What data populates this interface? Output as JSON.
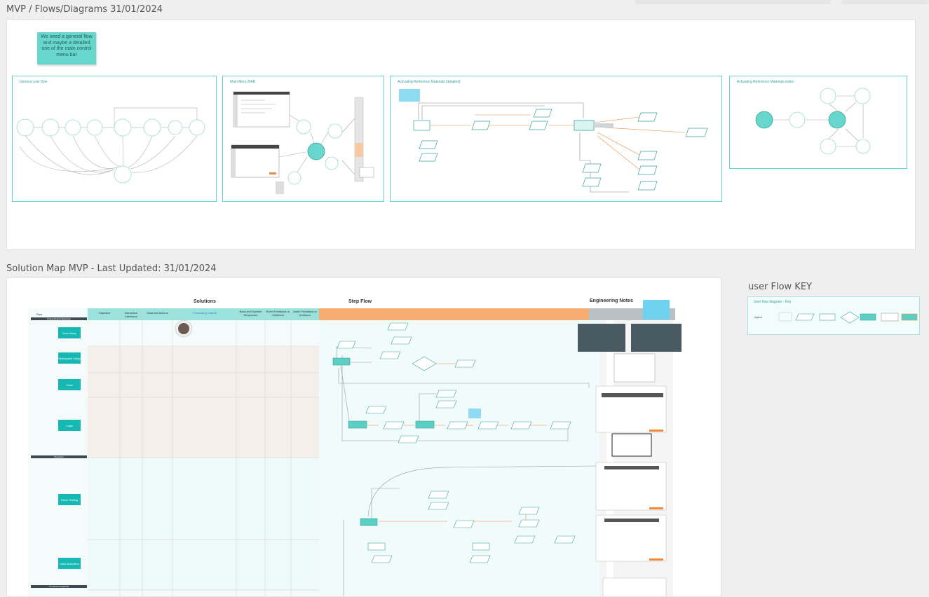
{
  "frames": {
    "mvp": {
      "title": "MVP / Flows/Diagrams 31/01/2024",
      "sticky_note": "We need a general flow and maybe a detailed one of the main control menu bar",
      "sub_frames": [
        {
          "title": "General user flow"
        },
        {
          "title": "Main Menu BAR"
        },
        {
          "title": "Activating Reference Materials [detailed]"
        },
        {
          "title": "Activating Reference Materials index"
        }
      ]
    },
    "solution_map": {
      "title": "Solution Map MVP - Last Updated: 31/01/2024",
      "section_headers": [
        "Solutions",
        "Step Flow",
        "Engineering Notes"
      ],
      "row_header": "Row",
      "column_headers": [
        "Objective",
        "Interactive Interfaces",
        "Data Interactions",
        "Processing Criteria",
        "Back-end System Responses",
        "Event Feedback or Guidance",
        "Audio Feedback or Guidance"
      ],
      "group_labels": [
        "Onboarding/Configuration",
        "Interaction",
        "Troubleshooting/FAQ"
      ],
      "rows": [
        {
          "label": "Seat Setup"
        },
        {
          "label": "Workspace Setup"
        },
        {
          "label": "Voice"
        },
        {
          "label": "Login"
        },
        {
          "label": "Home Setting"
        },
        {
          "label": "Voice Activation"
        }
      ]
    },
    "key": {
      "title": "user Flow KEY",
      "inner_title": "User flow diagram - Key",
      "legend_label": "Legend"
    }
  },
  "colors": {
    "accent": "#62d3cb",
    "row_label_fill": "#15b8b3",
    "step_flow_band": "#f7ad72",
    "engineering_band": "#b9c1c7",
    "sticky": "#67d6cc",
    "sticky_blue": "#6fd3ef",
    "connector_orange": "#f08a3c"
  }
}
